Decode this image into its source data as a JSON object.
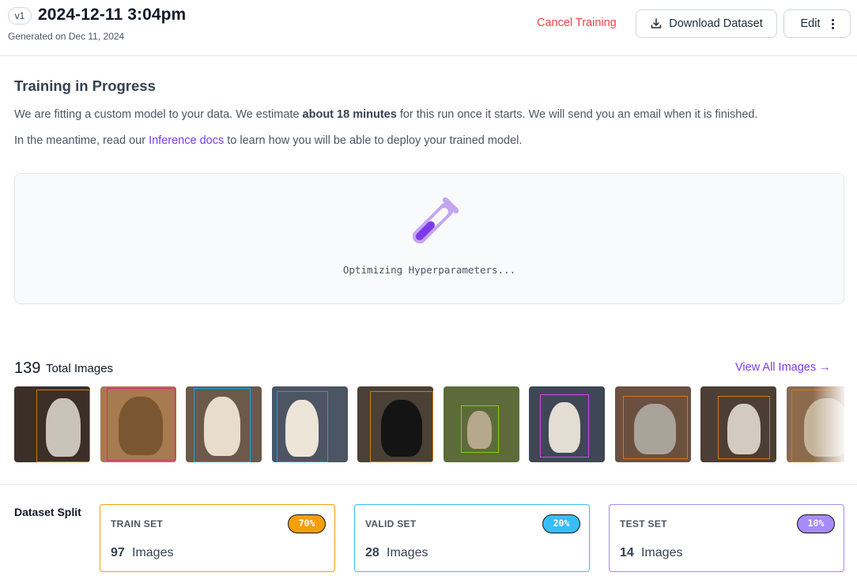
{
  "header": {
    "version_badge": "v1",
    "title": "2024-12-11 3:04pm",
    "generated_on": "Generated on Dec 11, 2024",
    "cancel_label": "Cancel Training",
    "download_label": "Download Dataset",
    "edit_label": "Edit"
  },
  "training": {
    "heading": "Training in Progress",
    "desc_prefix": "We are fitting a custom model to your data. We estimate ",
    "desc_bold": "about 18 minutes",
    "desc_suffix": " for this run once it starts. We will send you an email when it is finished.",
    "docs_prefix": "In the meantime, read our ",
    "docs_link": "Inference docs",
    "docs_suffix": " to learn how you will be able to deploy your trained model.",
    "status": "Optimizing Hyperparameters...",
    "icon": "flask-icon"
  },
  "images": {
    "count": "139",
    "label": "Total Images",
    "view_all": "View All Images →",
    "thumbs": [
      {
        "bg": "#3b2f27",
        "fg": "#c9c3b9",
        "box": "#d97706"
      },
      {
        "bg": "#a77a4f",
        "fg": "#7a5632",
        "box": "#db2777"
      },
      {
        "bg": "#6b5a4a",
        "fg": "#e8dccd",
        "box": "#0ea5e9"
      },
      {
        "bg": "#4b5563",
        "fg": "#ede5d8",
        "box": "#0ea5e9"
      },
      {
        "bg": "#4a4035",
        "fg": "#141414",
        "box": "#d97706"
      },
      {
        "bg": "#5d6b3a",
        "fg": "#b6a88a",
        "box": "#84cc16"
      },
      {
        "bg": "#3f4656",
        "fg": "#e3ddd4",
        "box": "#d946ef"
      },
      {
        "bg": "#6b5040",
        "fg": "#a9a39a",
        "box": "#d97706"
      },
      {
        "bg": "#4c3e34",
        "fg": "#d3cbbf",
        "box": "#d97706"
      },
      {
        "bg": "#8c6a4c",
        "fg": "#c4b29b",
        "box": "#d97706"
      }
    ]
  },
  "split": {
    "label": "Dataset Split",
    "sets": [
      {
        "name": "TRAIN SET",
        "pct": "70%",
        "count": "97",
        "unit": "Images",
        "color": "#f59e0b"
      },
      {
        "name": "VALID SET",
        "pct": "20%",
        "count": "28",
        "unit": "Images",
        "color": "#38bdf8"
      },
      {
        "name": "TEST SET",
        "pct": "10%",
        "count": "14",
        "unit": "Images",
        "color": "#a78bfa"
      }
    ]
  },
  "colors": {
    "accent": "#7c3aed",
    "danger": "#ef4444",
    "border": "#e5e7eb"
  }
}
